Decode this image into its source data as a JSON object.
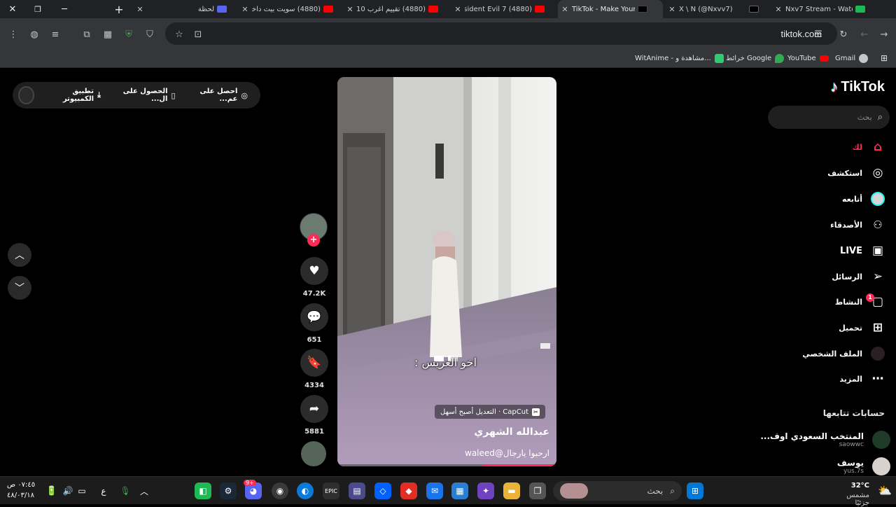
{
  "browser": {
    "window_controls": {
      "close": "✕",
      "restore": "❐",
      "minimize": "─"
    },
    "new_tab": "+",
    "tabs": [
      {
        "title": "Nxv7 Stream - Watch",
        "favicon_color": "#1db954",
        "active": false
      },
      {
        "title": "X \\ N (@Nxvv7)",
        "favicon_color": "#000000",
        "active": false
      },
      {
        "title": "TikTok - Make Your",
        "favicon_color": "#000000",
        "active": true
      },
      {
        "title": "(4880) Resident Evil 7",
        "favicon_color": "#ff0000",
        "active": false
      },
      {
        "title": "(4880) تقييم أغرب 10 ...",
        "favicon_color": "#ff0000",
        "active": false
      },
      {
        "title": "(4880) سويت بيت داخل",
        "favicon_color": "#ff0000",
        "active": false
      },
      {
        "title": "لحظة",
        "favicon_color": "#5865f2",
        "active": false
      }
    ],
    "url": "tiktok.com",
    "bookmarks": [
      {
        "label": "Gmail",
        "color": "#c4c7c5"
      },
      {
        "label": "YouTube",
        "color": "#ff0000"
      },
      {
        "label": "خرائط Google",
        "color": "#34a853"
      },
      {
        "label": "WitAnime - مشاهدة و...",
        "color": "#2ecc71"
      }
    ]
  },
  "page": {
    "top_pill": {
      "item1": "احصل على عم...",
      "item2": "الحصول على ال...",
      "item3": "تطبيق الكمبيوتر"
    },
    "video": {
      "caption": "اخو العريس :",
      "capcut_badge": "CapCut · التعديل أصبح أسهل",
      "author": "عبدالله الشهري",
      "description": "ارحبوا يارجال@waleed",
      "progress_fraction": 0.34
    },
    "actions": {
      "likes": "47.2K",
      "comments": "651",
      "saves": "4334",
      "shares": "5881"
    },
    "sidebar": {
      "logo": "TikTok",
      "search_placeholder": "بحث",
      "nav": [
        {
          "label": "لك",
          "icon": "home-icon",
          "glyph": "⌂",
          "active": true
        },
        {
          "label": "استكشف",
          "icon": "compass-icon",
          "glyph": "◎",
          "active": false
        },
        {
          "label": "أتابعه",
          "icon": "following-icon",
          "glyph": "●",
          "active": false
        },
        {
          "label": "الأصدقاء",
          "icon": "friends-icon",
          "glyph": "👥",
          "active": false
        },
        {
          "label": "LIVE",
          "icon": "live-icon",
          "glyph": "▣",
          "active": false
        },
        {
          "label": "الرسائل",
          "icon": "messages-icon",
          "glyph": "➢",
          "active": false
        },
        {
          "label": "النشاط",
          "icon": "activity-icon",
          "glyph": "▢",
          "active": false
        },
        {
          "label": "تحميل",
          "icon": "upload-icon",
          "glyph": "⊞",
          "active": false
        },
        {
          "label": "الملف الشخصي",
          "icon": "profile-icon",
          "glyph": "◉",
          "active": false
        },
        {
          "label": "المزيد",
          "icon": "more-icon",
          "glyph": "⋯",
          "active": false
        }
      ],
      "activity_badge": "1",
      "following_heading": "حسابات تتابعها",
      "following_accounts": [
        {
          "name": "المنتخب السعودي اوف...",
          "username": "saowwc"
        },
        {
          "name": "يوسف",
          "username": "yus.7s"
        }
      ]
    }
  },
  "taskbar": {
    "search_label": "بحث",
    "weather_temp": "32°C",
    "weather_text": "مشمس جزئيًا",
    "time": "٠٧:٤٥ ص",
    "date": "٤٨/٠٣/١٨",
    "lang": "ع",
    "discord_badge": "9+"
  }
}
